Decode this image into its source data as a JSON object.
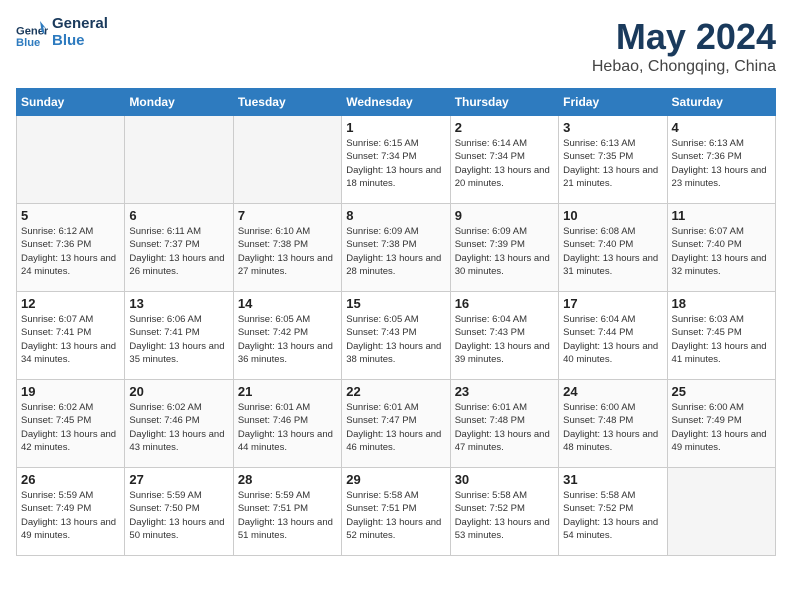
{
  "header": {
    "logo_line1": "General",
    "logo_line2": "Blue",
    "month": "May 2024",
    "location": "Hebao, Chongqing, China"
  },
  "weekdays": [
    "Sunday",
    "Monday",
    "Tuesday",
    "Wednesday",
    "Thursday",
    "Friday",
    "Saturday"
  ],
  "weeks": [
    [
      {
        "day": "",
        "empty": true
      },
      {
        "day": "",
        "empty": true
      },
      {
        "day": "",
        "empty": true
      },
      {
        "day": "1",
        "sunrise": "6:15 AM",
        "sunset": "7:34 PM",
        "daylight": "13 hours and 18 minutes."
      },
      {
        "day": "2",
        "sunrise": "6:14 AM",
        "sunset": "7:34 PM",
        "daylight": "13 hours and 20 minutes."
      },
      {
        "day": "3",
        "sunrise": "6:13 AM",
        "sunset": "7:35 PM",
        "daylight": "13 hours and 21 minutes."
      },
      {
        "day": "4",
        "sunrise": "6:13 AM",
        "sunset": "7:36 PM",
        "daylight": "13 hours and 23 minutes."
      }
    ],
    [
      {
        "day": "5",
        "sunrise": "6:12 AM",
        "sunset": "7:36 PM",
        "daylight": "13 hours and 24 minutes."
      },
      {
        "day": "6",
        "sunrise": "6:11 AM",
        "sunset": "7:37 PM",
        "daylight": "13 hours and 26 minutes."
      },
      {
        "day": "7",
        "sunrise": "6:10 AM",
        "sunset": "7:38 PM",
        "daylight": "13 hours and 27 minutes."
      },
      {
        "day": "8",
        "sunrise": "6:09 AM",
        "sunset": "7:38 PM",
        "daylight": "13 hours and 28 minutes."
      },
      {
        "day": "9",
        "sunrise": "6:09 AM",
        "sunset": "7:39 PM",
        "daylight": "13 hours and 30 minutes."
      },
      {
        "day": "10",
        "sunrise": "6:08 AM",
        "sunset": "7:40 PM",
        "daylight": "13 hours and 31 minutes."
      },
      {
        "day": "11",
        "sunrise": "6:07 AM",
        "sunset": "7:40 PM",
        "daylight": "13 hours and 32 minutes."
      }
    ],
    [
      {
        "day": "12",
        "sunrise": "6:07 AM",
        "sunset": "7:41 PM",
        "daylight": "13 hours and 34 minutes."
      },
      {
        "day": "13",
        "sunrise": "6:06 AM",
        "sunset": "7:41 PM",
        "daylight": "13 hours and 35 minutes."
      },
      {
        "day": "14",
        "sunrise": "6:05 AM",
        "sunset": "7:42 PM",
        "daylight": "13 hours and 36 minutes."
      },
      {
        "day": "15",
        "sunrise": "6:05 AM",
        "sunset": "7:43 PM",
        "daylight": "13 hours and 38 minutes."
      },
      {
        "day": "16",
        "sunrise": "6:04 AM",
        "sunset": "7:43 PM",
        "daylight": "13 hours and 39 minutes."
      },
      {
        "day": "17",
        "sunrise": "6:04 AM",
        "sunset": "7:44 PM",
        "daylight": "13 hours and 40 minutes."
      },
      {
        "day": "18",
        "sunrise": "6:03 AM",
        "sunset": "7:45 PM",
        "daylight": "13 hours and 41 minutes."
      }
    ],
    [
      {
        "day": "19",
        "sunrise": "6:02 AM",
        "sunset": "7:45 PM",
        "daylight": "13 hours and 42 minutes."
      },
      {
        "day": "20",
        "sunrise": "6:02 AM",
        "sunset": "7:46 PM",
        "daylight": "13 hours and 43 minutes."
      },
      {
        "day": "21",
        "sunrise": "6:01 AM",
        "sunset": "7:46 PM",
        "daylight": "13 hours and 44 minutes."
      },
      {
        "day": "22",
        "sunrise": "6:01 AM",
        "sunset": "7:47 PM",
        "daylight": "13 hours and 46 minutes."
      },
      {
        "day": "23",
        "sunrise": "6:01 AM",
        "sunset": "7:48 PM",
        "daylight": "13 hours and 47 minutes."
      },
      {
        "day": "24",
        "sunrise": "6:00 AM",
        "sunset": "7:48 PM",
        "daylight": "13 hours and 48 minutes."
      },
      {
        "day": "25",
        "sunrise": "6:00 AM",
        "sunset": "7:49 PM",
        "daylight": "13 hours and 49 minutes."
      }
    ],
    [
      {
        "day": "26",
        "sunrise": "5:59 AM",
        "sunset": "7:49 PM",
        "daylight": "13 hours and 49 minutes."
      },
      {
        "day": "27",
        "sunrise": "5:59 AM",
        "sunset": "7:50 PM",
        "daylight": "13 hours and 50 minutes."
      },
      {
        "day": "28",
        "sunrise": "5:59 AM",
        "sunset": "7:51 PM",
        "daylight": "13 hours and 51 minutes."
      },
      {
        "day": "29",
        "sunrise": "5:58 AM",
        "sunset": "7:51 PM",
        "daylight": "13 hours and 52 minutes."
      },
      {
        "day": "30",
        "sunrise": "5:58 AM",
        "sunset": "7:52 PM",
        "daylight": "13 hours and 53 minutes."
      },
      {
        "day": "31",
        "sunrise": "5:58 AM",
        "sunset": "7:52 PM",
        "daylight": "13 hours and 54 minutes."
      },
      {
        "day": "",
        "empty": true
      }
    ]
  ],
  "labels": {
    "sunrise": "Sunrise:",
    "sunset": "Sunset:",
    "daylight": "Daylight:"
  }
}
